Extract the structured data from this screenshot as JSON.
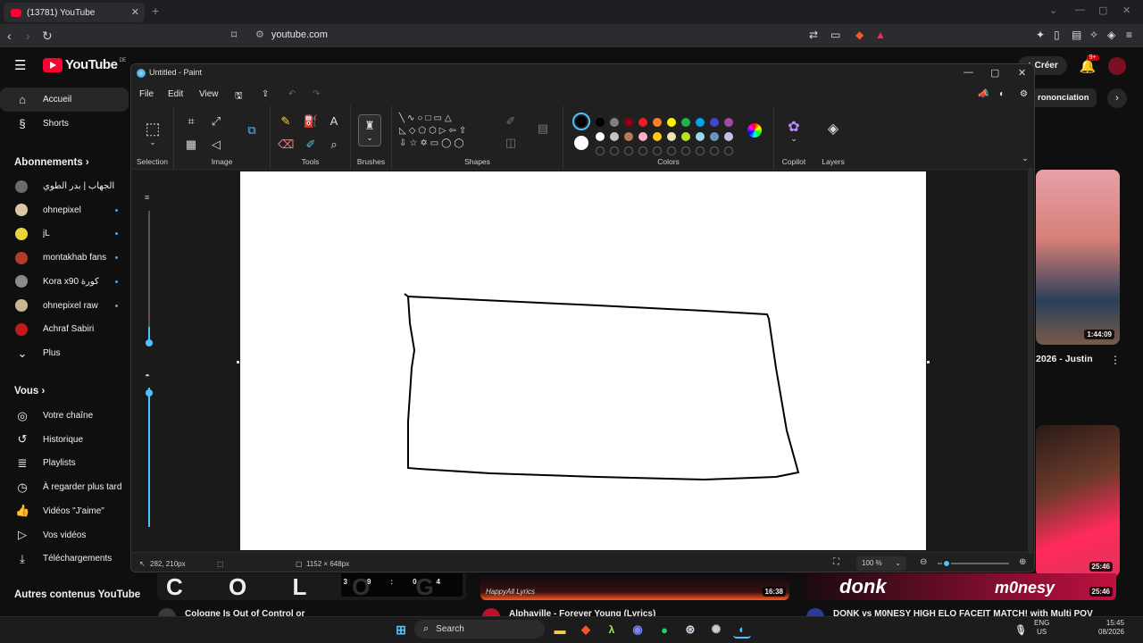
{
  "browser": {
    "tab_title": "(13781) YouTube",
    "new_tab": "+",
    "url": "youtube.com"
  },
  "youtube": {
    "logo_text": "YouTube",
    "logo_region": "DE",
    "main_nav": [
      {
        "label": "Accueil",
        "icon": "home-icon",
        "active": true
      },
      {
        "label": "Shorts",
        "icon": "shorts-icon",
        "active": false
      }
    ],
    "subscriptions_heading": "Abonnements",
    "subscriptions": [
      {
        "label": "ـية الجهاب | بدر الطوي",
        "color": "#6b6b6b",
        "dot": false
      },
      {
        "label": "ohnepixel",
        "color": "#d9c7a5",
        "dot": true
      },
      {
        "label": "jL",
        "color": "#e8d43a",
        "dot": true
      },
      {
        "label": "montakhab fans",
        "color": "#b43a2a",
        "dot": true
      },
      {
        "label": "Kora x90 كورة",
        "color": "#8a8a8a",
        "dot": true
      },
      {
        "label": "ohnepixel raw",
        "color": "#c9b592",
        "dot": true
      },
      {
        "label": "Achraf Sabiri",
        "color": "#c21a1a",
        "dot": false
      }
    ],
    "more_label": "Plus",
    "you_heading": "Vous",
    "you_items": [
      {
        "label": "Votre chaîne",
        "icon": "user-icon"
      },
      {
        "label": "Historique",
        "icon": "history-icon"
      },
      {
        "label": "Playlists",
        "icon": "playlist-icon"
      },
      {
        "label": "À regarder plus tard",
        "icon": "clock-icon"
      },
      {
        "label": "Vidéos \"J'aime\"",
        "icon": "like-icon"
      },
      {
        "label": "Vos vidéos",
        "icon": "video-icon"
      },
      {
        "label": "Téléchargements",
        "icon": "download-icon"
      }
    ],
    "other_heading": "Autres contenus YouTube",
    "create_label": "Créer",
    "notif_badge": "9+",
    "chip_label": "rononciation",
    "video1_title": "2026 - Justin",
    "video1_duration": "1:44:09",
    "video2_duration": "25:46",
    "bottom_videos": [
      {
        "title": "Cologne Is Out of Control or",
        "duration": "39:04",
        "art": "C O L O G N E"
      },
      {
        "title": "Alphaville - Forever Young (Lyrics)",
        "duration": "16:38",
        "art": "HappyAll Lyrics"
      },
      {
        "title": "DONK vs M0NESY HIGH ELO FACEIT MATCH! with Multi POV",
        "duration": "25:46",
        "art1": "donk",
        "art2": "m0nesy"
      }
    ]
  },
  "paint": {
    "title": "Untitled - Paint",
    "menu": [
      "File",
      "Edit",
      "View"
    ],
    "groups": {
      "selection": "Selection",
      "image": "Image",
      "tools": "Tools",
      "brushes": "Brushes",
      "shapes": "Shapes",
      "colors": "Colors",
      "copilot": "Copilot",
      "layers": "Layers"
    },
    "palette_row1": [
      "#000000",
      "#7f7f7f",
      "#880015",
      "#ed1c24",
      "#ff7f27",
      "#fff200",
      "#22b14c",
      "#00a2e8",
      "#3f48cc",
      "#a349a4"
    ],
    "palette_row2": [
      "#ffffff",
      "#c3c3c3",
      "#b97a57",
      "#ffaec9",
      "#ffc90e",
      "#efe4b0",
      "#b5e61d",
      "#99d9ea",
      "#7092be",
      "#c8bfe7"
    ],
    "primary_color": "#000000",
    "secondary_color": "#ffffff",
    "status": {
      "cursor_pos": "282, 210px",
      "canvas_size": "1152 × 648px",
      "zoom": "100 %"
    }
  },
  "taskbar": {
    "search_placeholder": "Search",
    "lang": "ENG",
    "region": "US",
    "time": "15:45",
    "date": "08/2026"
  }
}
